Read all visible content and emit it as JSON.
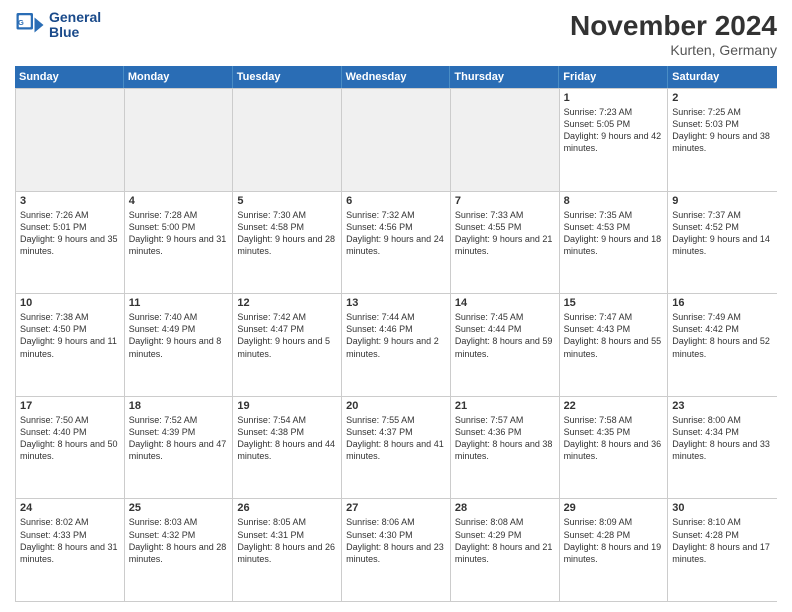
{
  "logo": {
    "line1": "General",
    "line2": "Blue"
  },
  "title": "November 2024",
  "location": "Kurten, Germany",
  "days": [
    "Sunday",
    "Monday",
    "Tuesday",
    "Wednesday",
    "Thursday",
    "Friday",
    "Saturday"
  ],
  "weeks": [
    [
      {
        "num": "",
        "info": ""
      },
      {
        "num": "",
        "info": ""
      },
      {
        "num": "",
        "info": ""
      },
      {
        "num": "",
        "info": ""
      },
      {
        "num": "",
        "info": ""
      },
      {
        "num": "1",
        "info": "Sunrise: 7:23 AM\nSunset: 5:05 PM\nDaylight: 9 hours and 42 minutes."
      },
      {
        "num": "2",
        "info": "Sunrise: 7:25 AM\nSunset: 5:03 PM\nDaylight: 9 hours and 38 minutes."
      }
    ],
    [
      {
        "num": "3",
        "info": "Sunrise: 7:26 AM\nSunset: 5:01 PM\nDaylight: 9 hours and 35 minutes."
      },
      {
        "num": "4",
        "info": "Sunrise: 7:28 AM\nSunset: 5:00 PM\nDaylight: 9 hours and 31 minutes."
      },
      {
        "num": "5",
        "info": "Sunrise: 7:30 AM\nSunset: 4:58 PM\nDaylight: 9 hours and 28 minutes."
      },
      {
        "num": "6",
        "info": "Sunrise: 7:32 AM\nSunset: 4:56 PM\nDaylight: 9 hours and 24 minutes."
      },
      {
        "num": "7",
        "info": "Sunrise: 7:33 AM\nSunset: 4:55 PM\nDaylight: 9 hours and 21 minutes."
      },
      {
        "num": "8",
        "info": "Sunrise: 7:35 AM\nSunset: 4:53 PM\nDaylight: 9 hours and 18 minutes."
      },
      {
        "num": "9",
        "info": "Sunrise: 7:37 AM\nSunset: 4:52 PM\nDaylight: 9 hours and 14 minutes."
      }
    ],
    [
      {
        "num": "10",
        "info": "Sunrise: 7:38 AM\nSunset: 4:50 PM\nDaylight: 9 hours and 11 minutes."
      },
      {
        "num": "11",
        "info": "Sunrise: 7:40 AM\nSunset: 4:49 PM\nDaylight: 9 hours and 8 minutes."
      },
      {
        "num": "12",
        "info": "Sunrise: 7:42 AM\nSunset: 4:47 PM\nDaylight: 9 hours and 5 minutes."
      },
      {
        "num": "13",
        "info": "Sunrise: 7:44 AM\nSunset: 4:46 PM\nDaylight: 9 hours and 2 minutes."
      },
      {
        "num": "14",
        "info": "Sunrise: 7:45 AM\nSunset: 4:44 PM\nDaylight: 8 hours and 59 minutes."
      },
      {
        "num": "15",
        "info": "Sunrise: 7:47 AM\nSunset: 4:43 PM\nDaylight: 8 hours and 55 minutes."
      },
      {
        "num": "16",
        "info": "Sunrise: 7:49 AM\nSunset: 4:42 PM\nDaylight: 8 hours and 52 minutes."
      }
    ],
    [
      {
        "num": "17",
        "info": "Sunrise: 7:50 AM\nSunset: 4:40 PM\nDaylight: 8 hours and 50 minutes."
      },
      {
        "num": "18",
        "info": "Sunrise: 7:52 AM\nSunset: 4:39 PM\nDaylight: 8 hours and 47 minutes."
      },
      {
        "num": "19",
        "info": "Sunrise: 7:54 AM\nSunset: 4:38 PM\nDaylight: 8 hours and 44 minutes."
      },
      {
        "num": "20",
        "info": "Sunrise: 7:55 AM\nSunset: 4:37 PM\nDaylight: 8 hours and 41 minutes."
      },
      {
        "num": "21",
        "info": "Sunrise: 7:57 AM\nSunset: 4:36 PM\nDaylight: 8 hours and 38 minutes."
      },
      {
        "num": "22",
        "info": "Sunrise: 7:58 AM\nSunset: 4:35 PM\nDaylight: 8 hours and 36 minutes."
      },
      {
        "num": "23",
        "info": "Sunrise: 8:00 AM\nSunset: 4:34 PM\nDaylight: 8 hours and 33 minutes."
      }
    ],
    [
      {
        "num": "24",
        "info": "Sunrise: 8:02 AM\nSunset: 4:33 PM\nDaylight: 8 hours and 31 minutes."
      },
      {
        "num": "25",
        "info": "Sunrise: 8:03 AM\nSunset: 4:32 PM\nDaylight: 8 hours and 28 minutes."
      },
      {
        "num": "26",
        "info": "Sunrise: 8:05 AM\nSunset: 4:31 PM\nDaylight: 8 hours and 26 minutes."
      },
      {
        "num": "27",
        "info": "Sunrise: 8:06 AM\nSunset: 4:30 PM\nDaylight: 8 hours and 23 minutes."
      },
      {
        "num": "28",
        "info": "Sunrise: 8:08 AM\nSunset: 4:29 PM\nDaylight: 8 hours and 21 minutes."
      },
      {
        "num": "29",
        "info": "Sunrise: 8:09 AM\nSunset: 4:28 PM\nDaylight: 8 hours and 19 minutes."
      },
      {
        "num": "30",
        "info": "Sunrise: 8:10 AM\nSunset: 4:28 PM\nDaylight: 8 hours and 17 minutes."
      }
    ]
  ]
}
